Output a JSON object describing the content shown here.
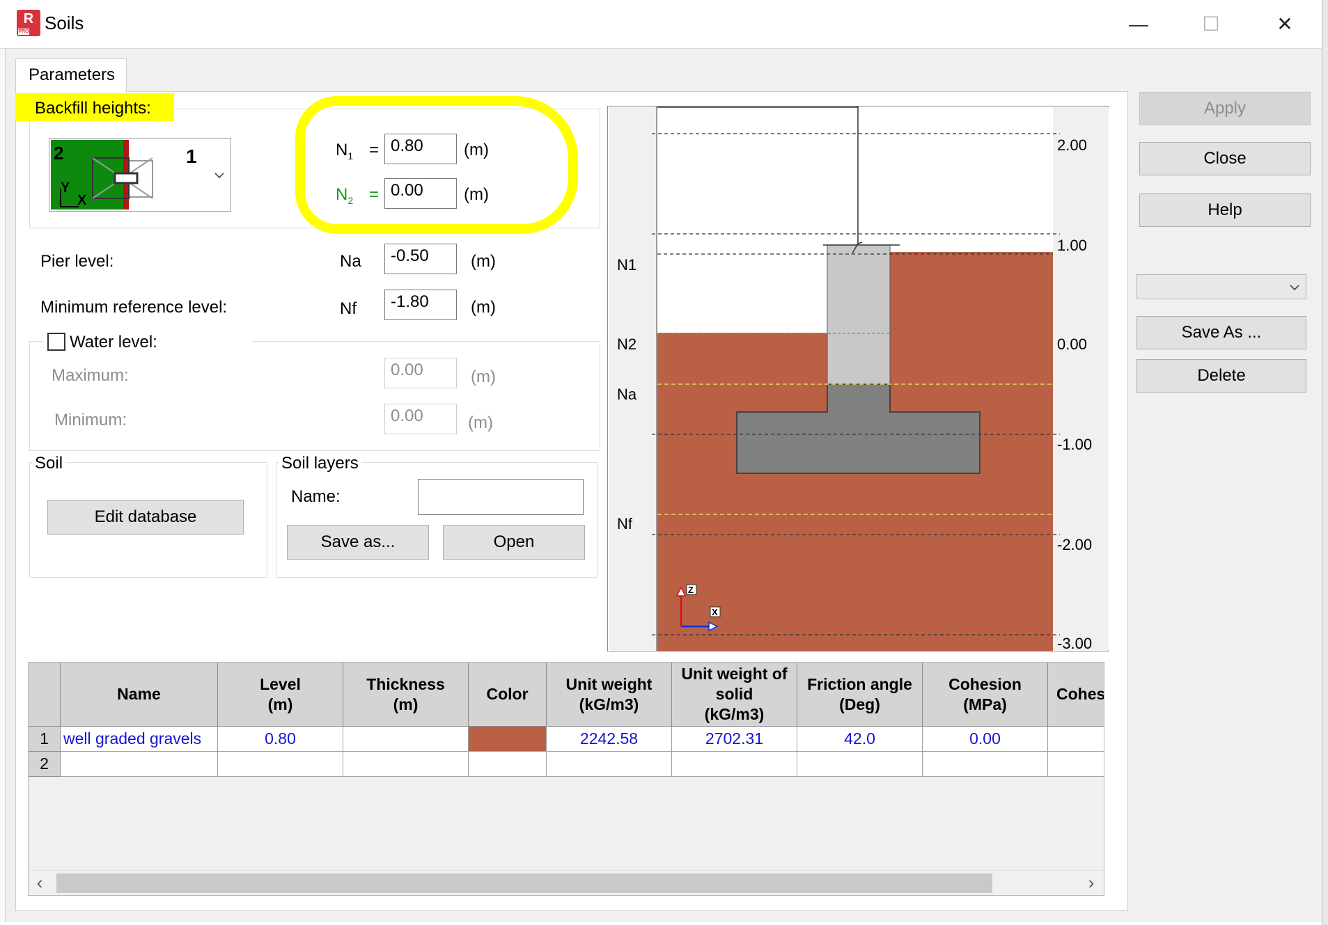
{
  "window": {
    "title": "Soils",
    "app_logo": "R",
    "app_logo_sub": "PRO",
    "minimize": "—",
    "maximize": "☐",
    "close": "✕"
  },
  "tabs": [
    {
      "label": "Parameters"
    }
  ],
  "backfill": {
    "label": "Backfill heights:",
    "selector_value": "1",
    "icon_number": "2",
    "icon_y": "Y",
    "icon_x": "X",
    "n1_label": "N",
    "n1_sub": "1",
    "n1_eq": "=",
    "n1_value": "0.80",
    "n2_label": "N",
    "n2_sub": "2",
    "n2_eq": "=",
    "n2_value": "0.00",
    "unit": "(m)"
  },
  "pier_level": {
    "label": "Pier level:",
    "symbol": "Na",
    "value": "-0.50",
    "unit": "(m)"
  },
  "min_ref_level": {
    "label": "Minimum reference level:",
    "symbol": "Nf",
    "value": "-1.80",
    "unit": "(m)"
  },
  "water_level": {
    "label": "Water level:",
    "checked": false,
    "maximum_label": "Maximum:",
    "maximum_value": "0.00",
    "minimum_label": "Minimum:",
    "minimum_value": "0.00",
    "unit": "(m)"
  },
  "soil": {
    "title": "Soil",
    "edit_button": "Edit database"
  },
  "soil_layers": {
    "title": "Soil layers",
    "name_label": "Name:",
    "name_value": "",
    "save_button": "Save as...",
    "open_button": "Open"
  },
  "side_buttons": {
    "apply": "Apply",
    "close": "Close",
    "help": "Help",
    "dropdown_value": "",
    "save_as": "Save As ...",
    "delete": "Delete"
  },
  "diagram": {
    "level_names": [
      "N1",
      "N2",
      "Na",
      "Nf"
    ],
    "axis_ticks": [
      "2.00",
      "1.00",
      "0.00",
      "-1.00",
      "-2.00",
      "-3.00"
    ],
    "axis_z": "Z",
    "axis_x": "X",
    "colors": {
      "soil": "#b96045",
      "pier": "#c8c8c8",
      "footing": "#808080"
    }
  },
  "table": {
    "columns": [
      {
        "label": "Name"
      },
      {
        "label": "Level\n(m)"
      },
      {
        "label": "Thickness\n(m)"
      },
      {
        "label": "Color"
      },
      {
        "label": "Unit weight\n(kG/m3)"
      },
      {
        "label": "Unit weight of\nsolid\n(kG/m3)"
      },
      {
        "label": "Friction angle\n(Deg)"
      },
      {
        "label": "Cohesion\n(MPa)"
      },
      {
        "label": "Cohes"
      }
    ],
    "rows": [
      {
        "num": "1",
        "name": "well graded gravels",
        "level": "0.80",
        "thickness": "",
        "color": "#b96045",
        "unit_weight": "2242.58",
        "unit_weight_solid": "2702.31",
        "friction": "42.0",
        "cohesion": "0.00"
      },
      {
        "num": "2",
        "name": "",
        "level": "",
        "thickness": "",
        "color": "",
        "unit_weight": "",
        "unit_weight_solid": "",
        "friction": "",
        "cohesion": ""
      }
    ],
    "scroll_left": "‹",
    "scroll_right": "›"
  }
}
